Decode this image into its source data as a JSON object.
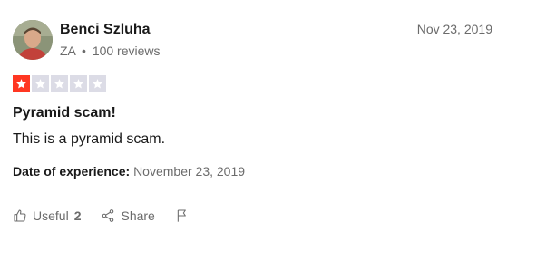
{
  "reviewer": {
    "name": "Benci Szluha",
    "country": "ZA",
    "separator": "•",
    "reviews_count": "100 reviews"
  },
  "review": {
    "date": "Nov 23, 2019",
    "rating": 1,
    "max_rating": 5,
    "title": "Pyramid scam!",
    "body": "This is a pyramid scam.",
    "experience_label": "Date of experience:",
    "experience_date": "November 23, 2019"
  },
  "actions": {
    "useful_label": "Useful",
    "useful_count": "2",
    "share_label": "Share",
    "flag_icon": "flag-icon",
    "thumb_icon": "thumbs-up-icon",
    "share_icon": "share-icon"
  },
  "colors": {
    "star_filled": "#ff3722",
    "star_empty": "#dcdce6",
    "text_primary": "#191919",
    "text_secondary": "#6b6b6b"
  }
}
